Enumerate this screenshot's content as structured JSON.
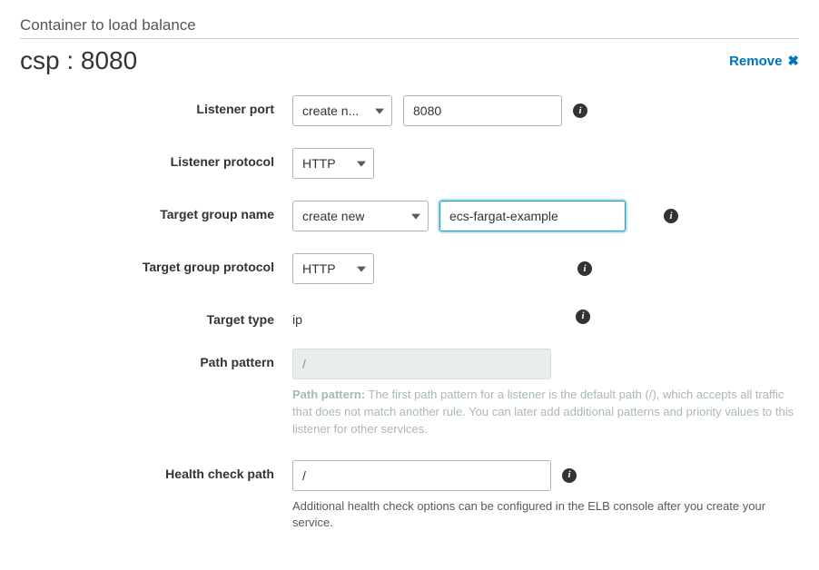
{
  "section_title": "Container to load balance",
  "header_name": "csp : 8080",
  "remove_label": "Remove",
  "fields": {
    "listener_port": {
      "label": "Listener port",
      "select_value": "create n...",
      "input_value": "8080"
    },
    "listener_protocol": {
      "label": "Listener protocol",
      "select_value": "HTTP"
    },
    "target_group_name": {
      "label": "Target group name",
      "select_value": "create new",
      "input_value": "ecs-fargat-example"
    },
    "target_group_protocol": {
      "label": "Target group protocol",
      "select_value": "HTTP"
    },
    "target_type": {
      "label": "Target type",
      "value": "ip"
    },
    "path_pattern": {
      "label": "Path pattern",
      "value": "/",
      "help_bold": "Path pattern:",
      "help_text": " The first path pattern for a listener is the default path (/), which accepts all traffic that does not match another rule. You can later add additional patterns and priority values to this listener for other services."
    },
    "health_check_path": {
      "label": "Health check path",
      "value": "/",
      "help_text": "Additional health check options can be configured in the ELB console after you create your service."
    }
  }
}
